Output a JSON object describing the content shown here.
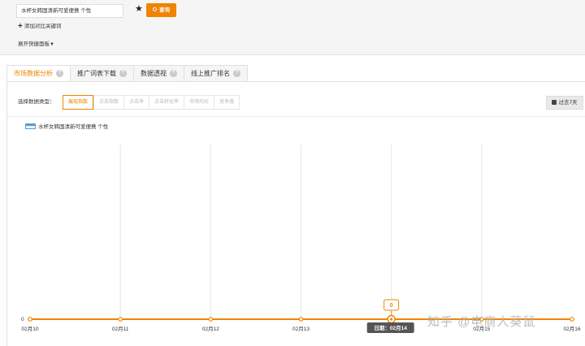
{
  "search": {
    "keyword_value": "水杯女韩国清新可爱便携 个性",
    "star_icon": "star-icon",
    "query_label": "查询",
    "query_icon": "search-icon",
    "add_compare_label": "添加对比关键词",
    "add_icon": "plus-icon",
    "expand_panel_label": "展开快捷面板",
    "caret_icon": "caret-down-icon"
  },
  "tabs": [
    {
      "label": "市场数据分析",
      "active": true
    },
    {
      "label": "推广词表下载",
      "active": false
    },
    {
      "label": "数据透视",
      "active": false
    },
    {
      "label": "线上推广排名",
      "active": false
    }
  ],
  "filters": {
    "type_label": "选择数据类型：",
    "types": [
      {
        "label": "展现指数",
        "active": true
      },
      {
        "label": "点击指数",
        "active": false
      },
      {
        "label": "点击率",
        "active": false
      },
      {
        "label": "点击转化率",
        "active": false
      },
      {
        "label": "市场均价",
        "active": false
      },
      {
        "label": "竞争度",
        "active": false
      }
    ],
    "range_label": "过去7天",
    "range_icon": "calendar-icon"
  },
  "colors": {
    "accent": "#f08300",
    "series": "#f08300",
    "legend": "#5b9bd5"
  },
  "chart_data": {
    "type": "line",
    "x": [
      "02月10",
      "02月11",
      "02月12",
      "02月13",
      "02月14",
      "02月15",
      "02月16"
    ],
    "series": [
      {
        "name": "水杯女韩国清新可爱便携 个性",
        "values": [
          0,
          0,
          0,
          0,
          0,
          0,
          0
        ]
      }
    ],
    "ylim": [
      0,
      1
    ],
    "y_ticks": [
      "0"
    ],
    "grid": true,
    "legend_position": "top-left",
    "tooltip": {
      "value": "0",
      "label": "日期：02月14"
    }
  },
  "watermark": "知乎 @电商人葵鼠"
}
